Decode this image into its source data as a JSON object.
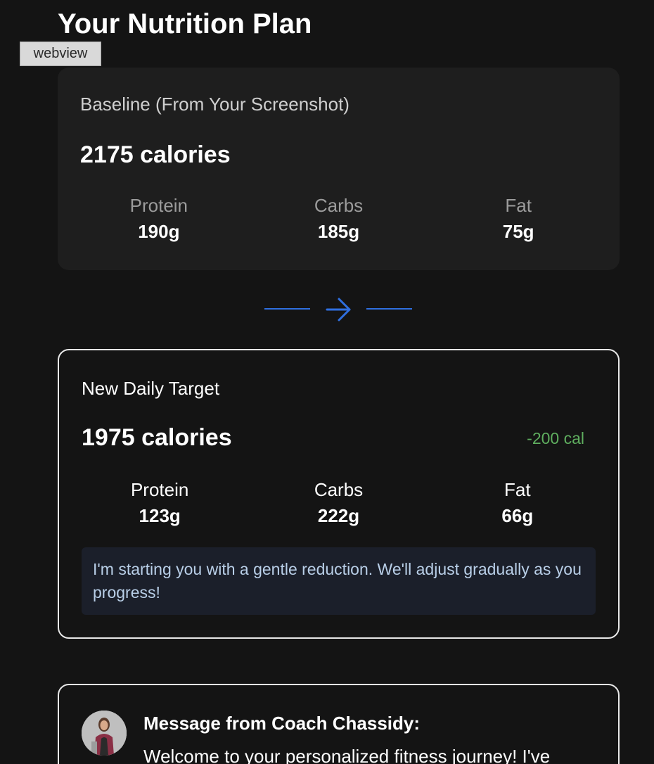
{
  "header": {
    "title": "Your Nutrition Plan",
    "webview_label": "webview"
  },
  "baseline": {
    "label": "Baseline (From Your Screenshot)",
    "calories": "2175 calories",
    "macros": [
      {
        "name": "Protein",
        "value": "190g"
      },
      {
        "name": "Carbs",
        "value": "185g"
      },
      {
        "name": "Fat",
        "value": "75g"
      }
    ]
  },
  "target": {
    "label": "New Daily Target",
    "calories": "1975 calories",
    "delta": "-200 cal",
    "macros": [
      {
        "name": "Protein",
        "value": "123g"
      },
      {
        "name": "Carbs",
        "value": "222g"
      },
      {
        "name": "Fat",
        "value": "66g"
      }
    ],
    "note": "I'm starting you with a gentle reduction. We'll adjust gradually as you progress!"
  },
  "coach": {
    "heading": "Message from Coach Chassidy:",
    "message": "Welcome to your personalized fitness journey! I've"
  },
  "icons": {
    "transition": "arrow-right-icon",
    "avatar": "coach-avatar"
  },
  "colors": {
    "accent": "#2f6fe0",
    "delta": "#5fae5f",
    "note_bg": "#1b1f2a",
    "note_text": "#b9cfe8"
  }
}
